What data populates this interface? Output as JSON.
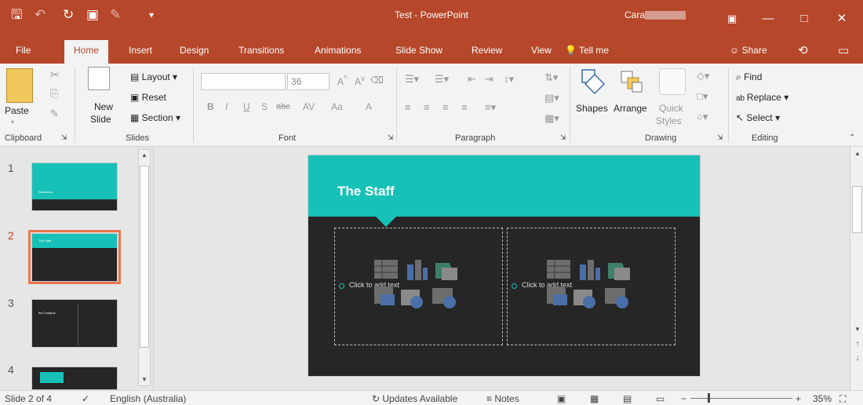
{
  "window": {
    "title": "Test - PowerPoint",
    "user": "Cara"
  },
  "tabs": {
    "items": [
      "File",
      "Home",
      "Insert",
      "Design",
      "Transitions",
      "Animations",
      "Slide Show",
      "Review",
      "View"
    ],
    "tell_me": "Tell me",
    "share": "Share"
  },
  "ribbon": {
    "clipboard": {
      "paste": "Paste",
      "label": "Clipboard"
    },
    "slides": {
      "new_slide_1": "New",
      "new_slide_2": "Slide",
      "layout": "Layout",
      "reset": "Reset",
      "section": "Section",
      "label": "Slides"
    },
    "font": {
      "font_name": "",
      "font_size": "36",
      "label": "Font",
      "bold": "B",
      "italic": "I",
      "underline": "U",
      "shadow": "S",
      "strike": "abc",
      "spacing": "AV",
      "case": "Aa",
      "color": "A",
      "grow": "A",
      "shrink": "A"
    },
    "paragraph": {
      "label": "Paragraph"
    },
    "drawing": {
      "shapes": "Shapes",
      "arrange": "Arrange",
      "quick_styles_1": "Quick",
      "quick_styles_2": "Styles",
      "label": "Drawing"
    },
    "editing": {
      "find": "Find",
      "replace": "Replace",
      "select": "Select",
      "label": "Editing"
    }
  },
  "thumbnails": [
    {
      "number": "1",
      "title": "Slideshow"
    },
    {
      "number": "2",
      "title": "The Staff"
    },
    {
      "number": "3",
      "title": "the Campus"
    },
    {
      "number": "4",
      "title": ""
    }
  ],
  "slide": {
    "title": "The Staff",
    "left_placeholder": "Click to add text",
    "right_placeholder": "Click to add text"
  },
  "status": {
    "slide_info": "Slide 2 of 4",
    "language": "English (Australia)",
    "updates": "Updates Available",
    "notes": "Notes",
    "zoom": "35%",
    "zoom_level_percent": 35
  },
  "colors": {
    "accent": "#b7472a",
    "slide_teal": "#17c1b7",
    "slide_dark": "#262626",
    "selection": "#e8754e"
  },
  "icons": [
    "save-icon",
    "undo-icon",
    "redo-icon",
    "start-from-beginning-icon",
    "customize-qat-icon",
    "ribbon-display-icon",
    "minimize-icon",
    "maximize-icon",
    "close-icon",
    "lightbulb-icon",
    "share-icon",
    "history-icon",
    "comments-icon"
  ]
}
